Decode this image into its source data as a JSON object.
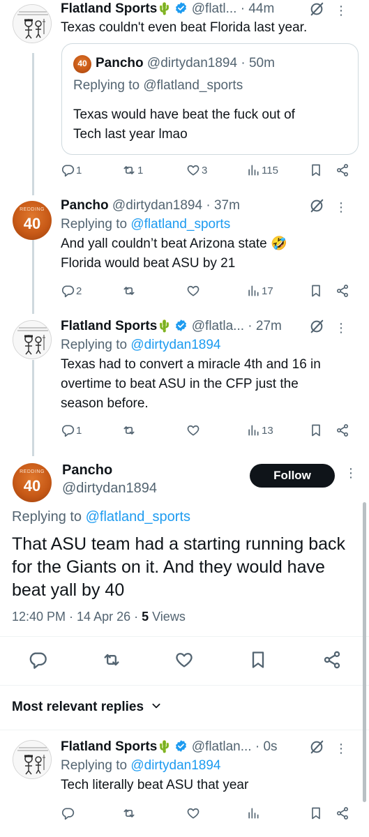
{
  "tweets": [
    {
      "name": "Flatland Sports",
      "emoji": "🌵",
      "handle": "@flatl...",
      "time": "· 44m",
      "text": "Texas couldn't even beat Florida last year.",
      "quote": {
        "avatar_num": "40",
        "name": "Pancho",
        "handle": "@dirtydan1894",
        "time": "· 50m",
        "reply_prefix": "Replying to ",
        "reply_mention": "@flatland_sports",
        "text_lines": [
          "Texas would have beat the fuck out of",
          "Tech last year lmao"
        ]
      },
      "replies": "1",
      "reposts": "1",
      "likes": "3",
      "views": "115"
    },
    {
      "name": "Pancho",
      "handle": "@dirtydan1894",
      "time": "· 37m",
      "reply_prefix": "Replying to ",
      "reply_mention": "@flatland_sports",
      "text_lines": [
        "And yall couldn’t beat Arizona state 🤣",
        "Florida would beat ASU by 21"
      ],
      "replies": "2",
      "views": "17"
    },
    {
      "name": "Flatland Sports",
      "emoji": "🌵",
      "handle": "@flatla...",
      "time": "· 27m",
      "reply_prefix": "Replying to ",
      "reply_mention": "@dirtydan1894",
      "text_lines": [
        "Texas had to convert a miracle 4th and 16 in",
        "overtime to beat ASU in the CFP just the",
        "season before."
      ],
      "replies": "1",
      "views": "13"
    }
  ],
  "main_tweet": {
    "avatar_num": "40",
    "avatar_jersey_name": "REDDING",
    "name": "Pancho",
    "handle": "@dirtydan1894",
    "follow_label": "Follow",
    "reply_prefix": "Replying to ",
    "reply_mention": "@flatland_sports",
    "text_lines": [
      "That ASU team had a starting running back",
      "for the Giants on it. And they would have",
      "beat yall by 40"
    ],
    "timestamp": "12:40 PM · 14 Apr 26 · ",
    "views_count": "5",
    "views_label": " Views"
  },
  "sort_label": "Most relevant replies",
  "reply_tweet": {
    "name": "Flatland Sports",
    "emoji": "🌵",
    "handle": "@flatlan...",
    "time": "· 0s",
    "reply_prefix": "Replying to ",
    "reply_mention": "@dirtydan1894",
    "text": "Tech literally beat ASU that year"
  },
  "colors": {
    "accent": "#1d9bf0",
    "text": "#0f1419",
    "muted": "#536471",
    "border": "#cfd9de"
  },
  "icons": [
    "verified-badge-icon",
    "grok-icon",
    "more-icon",
    "reply-icon",
    "repost-icon",
    "like-icon",
    "views-icon",
    "bookmark-icon",
    "share-icon",
    "chevron-down-icon",
    "cactus-emoji"
  ]
}
